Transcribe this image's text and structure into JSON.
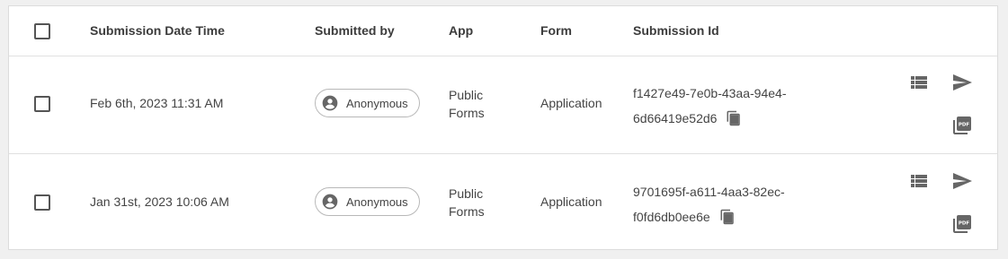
{
  "table": {
    "headers": {
      "date": "Submission Date Time",
      "submitted_by": "Submitted by",
      "app": "App",
      "form": "Form",
      "submission_id": "Submission Id"
    },
    "rows": [
      {
        "date": "Feb 6th, 2023 11:31 AM",
        "submitted_by": "Anonymous",
        "app_line1": "Public",
        "app_line2": "Forms",
        "form": "Application",
        "submission_id_line1": "f1427e49-7e0b-43aa-94e4-",
        "submission_id_line2": "6d66419e52d6"
      },
      {
        "date": "Jan 31st, 2023 10:06 AM",
        "submitted_by": "Anonymous",
        "app_line1": "Public",
        "app_line2": "Forms",
        "form": "Application",
        "submission_id_line1": "9701695f-a611-4aa3-82ec-",
        "submission_id_line2": "f0fd6db0ee6e"
      }
    ]
  },
  "icons": {
    "avatar": "account-circle-icon",
    "copy": "content-copy-icon",
    "view": "view-list-icon",
    "send": "send-icon",
    "pdf": "picture-as-pdf-icon"
  },
  "colors": {
    "icon": "#666666",
    "chip_border": "#b8b8b8",
    "divider": "#e0e0e0"
  }
}
